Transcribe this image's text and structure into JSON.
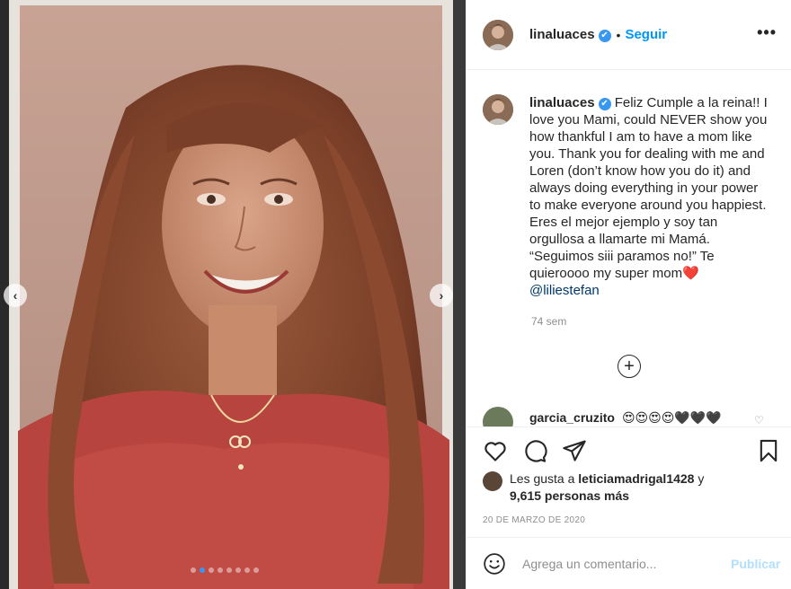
{
  "post": {
    "username": "linaluaces",
    "verified_mark": "✔",
    "separator": "•",
    "follow_label": "Seguir",
    "more_label": "•••"
  },
  "media": {
    "prev_arrow": "‹",
    "next_arrow": "›",
    "slide_count": 8,
    "active_slide": 2
  },
  "caption": {
    "username": "linaluaces",
    "text": " Feliz Cumple a la reina!! I love you Mami, could NEVER show you how thankful I am to have a mom like you. Thank you for dealing with me and Loren (don’t know how you do it) and always doing everything in your power to make everyone around you happiest. Eres el mejor ejemplo y soy tan orgullosa a llamarte mi Mamá. “Seguimos siii paramos no!” Te quieroooo my super mom❤️",
    "mention": "@liliestefan",
    "age": "74 sem"
  },
  "load_more": {
    "label": "+"
  },
  "comment": {
    "username": "garcia_cruzito",
    "text": "😍😍😍😍🖤🖤🖤",
    "like_icon": "♡"
  },
  "actions": {
    "likes_prefix": "Les gusta a ",
    "likes_user": "leticiamadrigal1428",
    "likes_conj": " y",
    "likes_others": "9,615 personas más",
    "date": "20 DE MARZO DE 2020"
  },
  "add_comment": {
    "placeholder": "Agrega un comentario...",
    "post_label": "Publicar"
  },
  "colors": {
    "accent": "#0095f6",
    "verified": "#3897f0",
    "publish_disabled": "#b2dffc"
  }
}
